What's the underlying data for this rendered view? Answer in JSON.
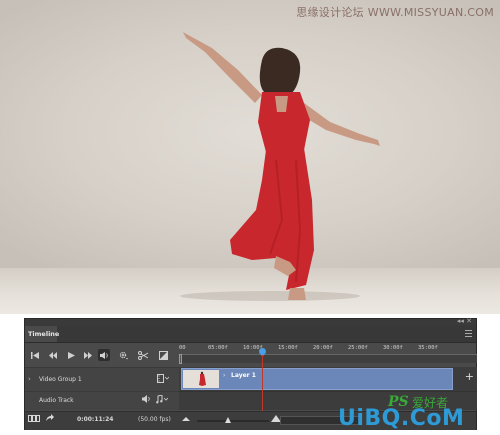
{
  "watermark": "思缘设计论坛 WWW.MISSYUAN.COM",
  "timeline": {
    "tab_label": "Timeline",
    "ruler_ticks": [
      "00",
      "05:00f",
      "10:00f",
      "15:00f",
      "20:00f",
      "25:00f",
      "30:00f",
      "35:00f"
    ],
    "tracks": {
      "video_group": "Video Group 1",
      "audio_track": "Audio Track"
    },
    "clip_label": "Layer 1",
    "add_track": "+",
    "timecode": "0:00:11:24",
    "fps": "(50.00 fps)"
  },
  "controls_icons": [
    "go-to-first-frame-icon",
    "previous-frame-icon",
    "play-icon",
    "next-frame-icon",
    "audio-icon",
    "settings-icon",
    "split-scissors-icon",
    "transition-icon"
  ],
  "logo": {
    "ps": "PS",
    "cn": "爱好者",
    "main": "UiBQ.CoM",
    "domain": ""
  },
  "colors": {
    "dress": "#c8272d",
    "clip": "#6b86b8",
    "playhead": "#4a9fe6",
    "panel": "#4a4a4a",
    "logo_blue": "#2e9ad6",
    "logo_green": "#3aa83a"
  }
}
